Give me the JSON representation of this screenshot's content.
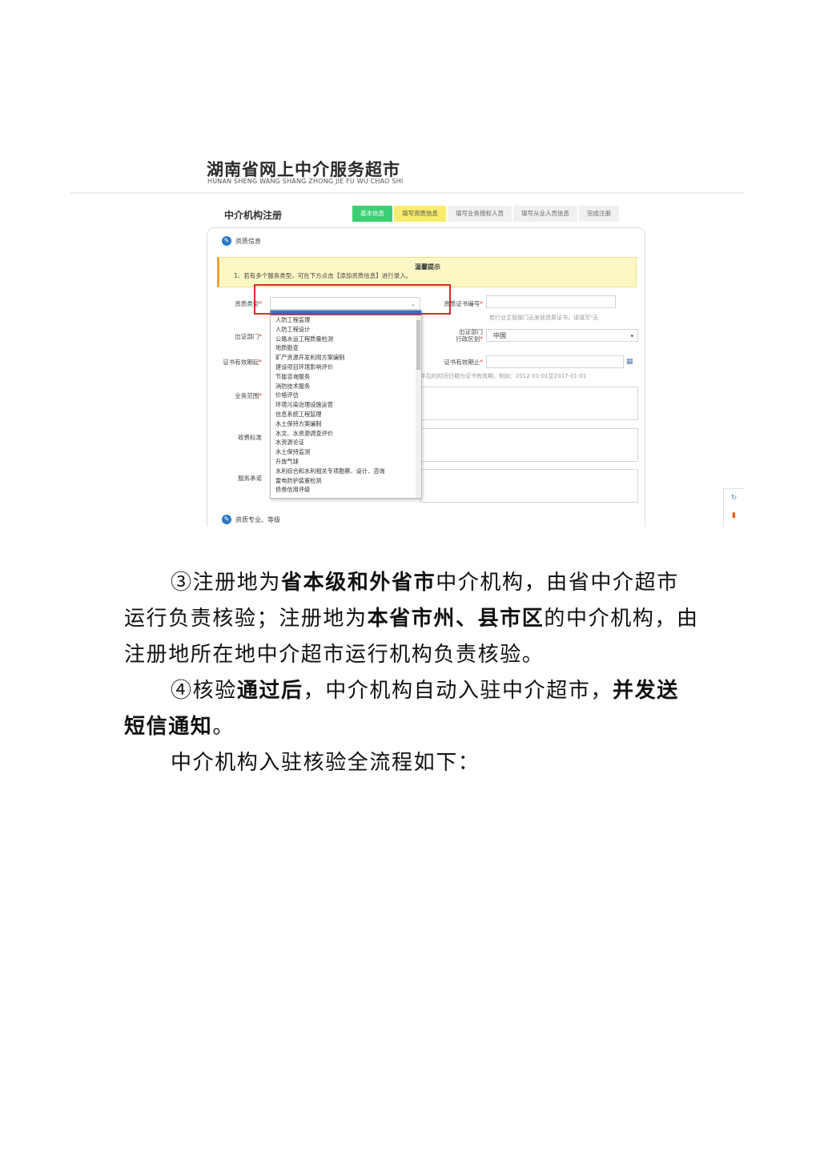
{
  "brand": {
    "title": "湖南省网上中介服务超市",
    "subtitle": "HUNAN SHENG WANG SHANG ZHONG JIE FU WU CHAO SHI"
  },
  "registration": {
    "title": "中介机构注册",
    "steps": [
      {
        "label": "基本信息",
        "state": "done"
      },
      {
        "label": "填写资质信息",
        "state": "active"
      },
      {
        "label": "填写业务授权人员",
        "state": "todo"
      },
      {
        "label": "填写从业人员信息",
        "state": "todo"
      },
      {
        "label": "完成注册",
        "state": "todo"
      }
    ],
    "section1": "资质信息",
    "section2": "资质专业、等级",
    "notice": {
      "title": "温馨提示",
      "text": "1、若有多个服务类型，可在下方点击【添加资质信息】进行录入。"
    },
    "fields": {
      "qual_type": "资质类型",
      "cert_no": "资质证书编号",
      "cert_no_hint": "若行业主管部门无发放资质证书，请填写\"无",
      "issuer": "出证部门",
      "region": "出证部门\n行政区划",
      "region_value": "中国",
      "valid_from": "证书有效期起",
      "valid_to": "证书有效期止",
      "validity_hint": "年后的时间日期为证书有效期，例如：2012-01-01至2017-01-01",
      "scope": "业务范围",
      "fee": "收费标准",
      "promise": "服务承诺",
      "required_mark": "*"
    },
    "dropdown_options": [
      "人防工程监理",
      "人防工程设计",
      "公路水运工程质量检测",
      "地质勘查",
      "矿产资源开发利用方案编制",
      "建设项目环境影响评价",
      "节能咨询服务",
      "消防技术服务",
      "价格评估",
      "环境污染治理设施运营",
      "信息系统工程监理",
      "水土保持方案编制",
      "水文、水资源调查评价",
      "水资源论证",
      "水土保持监测",
      "升放气球",
      "水利综合和水利相关专项勘察、设计、咨询",
      "雷电防护装置检测",
      "债券信用评级"
    ]
  },
  "document": {
    "p1": [
      {
        "t": "③注册地为",
        "b": false
      },
      {
        "t": "省本级和外省市",
        "b": true
      },
      {
        "t": "中介机构，由省中介超市运行负责核验；注册地为",
        "b": false
      },
      {
        "t": "本省市州、县市区",
        "b": true
      },
      {
        "t": "的中介机构，由注册地所在地中介超市运行机构负责核验。",
        "b": false
      }
    ],
    "p2": [
      {
        "t": "④核验",
        "b": false
      },
      {
        "t": "通过后",
        "b": true
      },
      {
        "t": "，中介机构自动入驻中介超市，",
        "b": false
      },
      {
        "t": "并发送短信通知",
        "b": true
      },
      {
        "t": "。",
        "b": false
      }
    ],
    "p3": "中介机构入驻核验全流程如下："
  }
}
